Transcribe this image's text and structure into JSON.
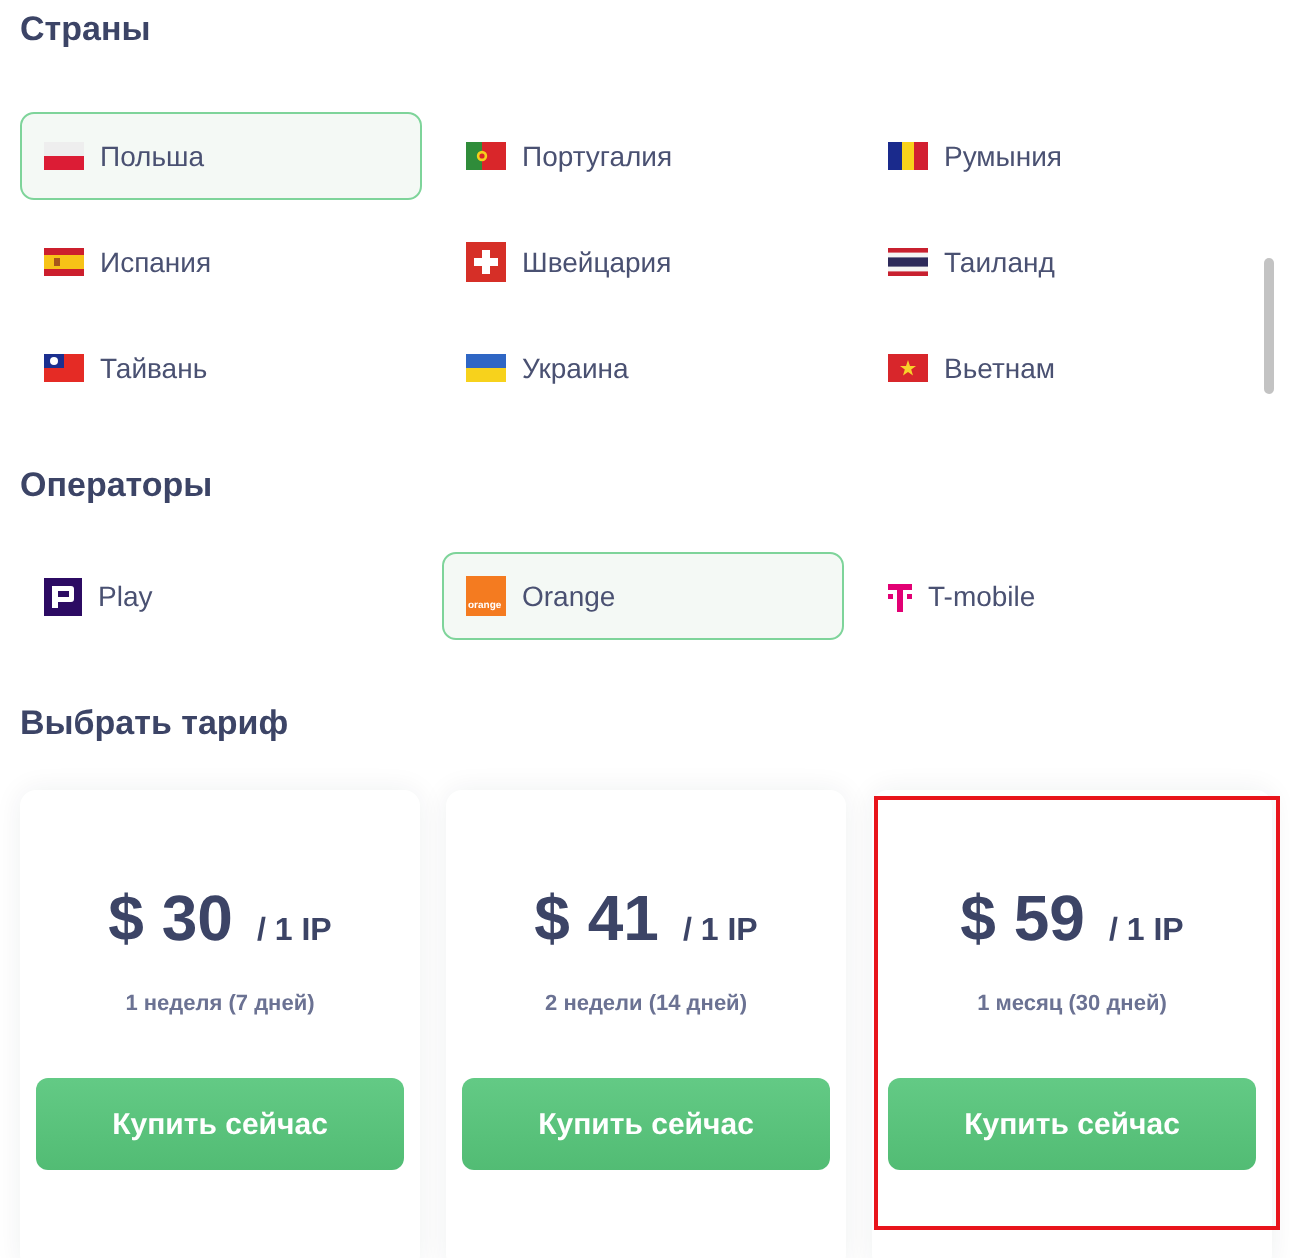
{
  "countries": {
    "title": "Страны",
    "items": [
      {
        "name": "Польша",
        "kind": "poland",
        "selected": true
      },
      {
        "name": "Португалия",
        "kind": "portugal",
        "selected": false
      },
      {
        "name": "Румыния",
        "kind": "romania",
        "selected": false
      },
      {
        "name": "Испания",
        "kind": "spain",
        "selected": false
      },
      {
        "name": "Швейцария",
        "kind": "switzerland",
        "selected": false
      },
      {
        "name": "Таиланд",
        "kind": "thailand",
        "selected": false
      },
      {
        "name": "Тайвань",
        "kind": "taiwan",
        "selected": false
      },
      {
        "name": "Украина",
        "kind": "ukraine",
        "selected": false
      },
      {
        "name": "Вьетнам",
        "kind": "vietnam",
        "selected": false
      }
    ]
  },
  "operators": {
    "title": "Операторы",
    "items": [
      {
        "name": "Play",
        "kind": "play",
        "selected": false
      },
      {
        "name": "Orange",
        "kind": "orange",
        "logo_text": "orange",
        "selected": true
      },
      {
        "name": "T-mobile",
        "kind": "tmobile",
        "selected": false
      }
    ]
  },
  "plans": {
    "title": "Выбрать тариф",
    "items": [
      {
        "price": "$ 30",
        "unit": "/ 1 IP",
        "period": "1 неделя (7 дней)",
        "button": "Купить сейчас",
        "highlighted": false
      },
      {
        "price": "$ 41",
        "unit": "/ 1 IP",
        "period": "2 недели (14 дней)",
        "button": "Купить сейчас",
        "highlighted": false
      },
      {
        "price": "$ 59",
        "unit": "/ 1 IP",
        "period": "1 месяц (30 дней)",
        "button": "Купить сейчас",
        "highlighted": true
      }
    ]
  }
}
